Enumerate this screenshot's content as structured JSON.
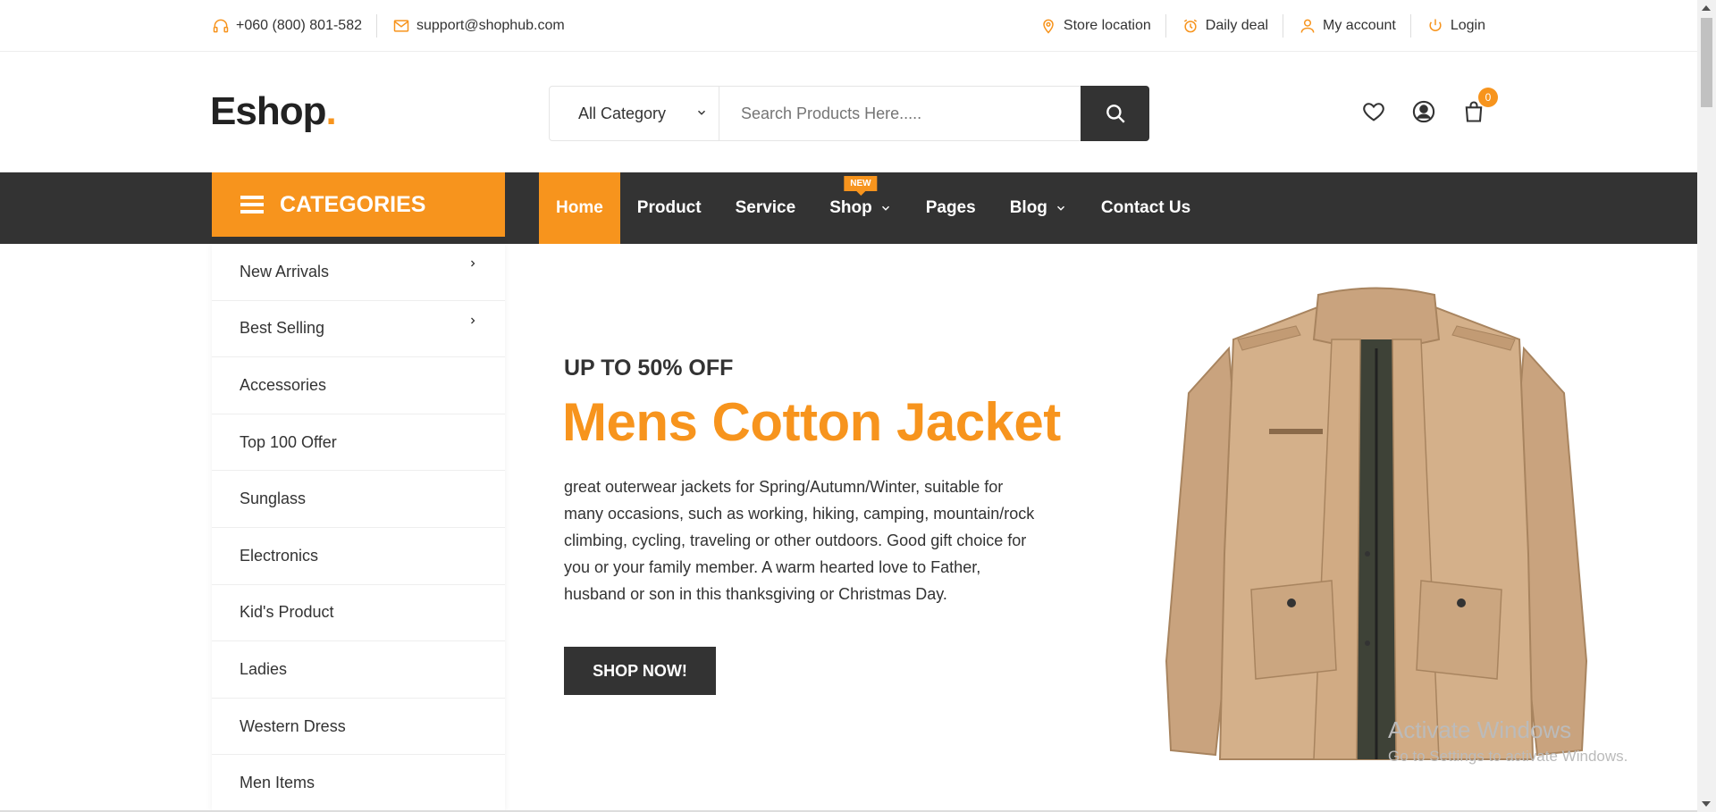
{
  "topbar": {
    "phone": "+060 (800) 801-582",
    "email": "support@shophub.com",
    "links": [
      {
        "label": "Store location",
        "icon": "location-pin-icon"
      },
      {
        "label": "Daily deal",
        "icon": "alarm-clock-icon"
      },
      {
        "label": "My account",
        "icon": "user-icon"
      },
      {
        "label": "Login",
        "icon": "power-icon"
      }
    ]
  },
  "header": {
    "logo_text": "Eshop",
    "logo_dot": ".",
    "category_select": "All Category",
    "search_placeholder": "Search Products Here.....",
    "cart_count": "0"
  },
  "nav": {
    "categories_label": "CATEGORIES",
    "items": [
      {
        "label": "Home",
        "active": true
      },
      {
        "label": "Product"
      },
      {
        "label": "Service"
      },
      {
        "label": "Shop",
        "badge": "NEW",
        "dropdown": true
      },
      {
        "label": "Pages"
      },
      {
        "label": "Blog",
        "dropdown": true
      },
      {
        "label": "Contact Us"
      }
    ]
  },
  "sidebar": {
    "items": [
      {
        "label": "New Arrivals",
        "has_submenu": true
      },
      {
        "label": "Best Selling",
        "has_submenu": true
      },
      {
        "label": "Accessories"
      },
      {
        "label": "Top 100 Offer"
      },
      {
        "label": "Sunglass"
      },
      {
        "label": "Electronics"
      },
      {
        "label": "Kid's Product"
      },
      {
        "label": "Ladies"
      },
      {
        "label": "Western Dress"
      },
      {
        "label": "Men Items"
      }
    ]
  },
  "hero": {
    "subtitle": "UP TO 50% OFF",
    "title": "Mens Cotton Jacket",
    "description": "great outerwear jackets for Spring/Autumn/Winter, suitable for many occasions, such as working, hiking, camping, mountain/rock climbing, cycling, traveling or other outdoors. Good gift choice for you or your family member. A warm hearted love to Father, husband or son in this thanksgiving or Christmas Day.",
    "button_label": "SHOP NOW!"
  },
  "watermark": {
    "line1": "Activate Windows",
    "line2": "Go to Settings to activate Windows."
  },
  "colors": {
    "accent": "#f7941d",
    "dark": "#333333"
  }
}
